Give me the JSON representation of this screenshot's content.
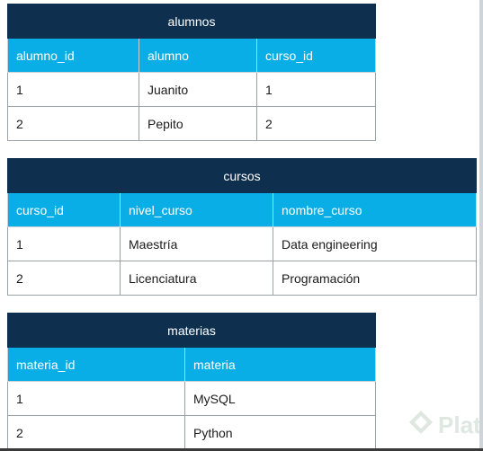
{
  "tables": [
    {
      "title": "alumnos",
      "headers": [
        "alumno_id",
        "alumno",
        "curso_id"
      ],
      "rows": [
        [
          "1",
          "Juanito",
          "1"
        ],
        [
          "2",
          "Pepito",
          "2"
        ]
      ]
    },
    {
      "title": "cursos",
      "headers": [
        "curso_id",
        "nivel_curso",
        "nombre_curso"
      ],
      "rows": [
        [
          "1",
          "Maestría",
          "Data engineering"
        ],
        [
          "2",
          "Licenciatura",
          "Programación"
        ]
      ]
    },
    {
      "title": "materias",
      "headers": [
        "materia_id",
        "materia"
      ],
      "rows": [
        [
          "1",
          "MySQL"
        ],
        [
          "2",
          "Python"
        ]
      ]
    }
  ],
  "watermark": {
    "text": "Plat",
    "icon": "platzi-logo-icon"
  },
  "colors": {
    "title_bg": "#0e2f4e",
    "header_bg": "#0aaee6",
    "border": "#9aa2a8"
  }
}
